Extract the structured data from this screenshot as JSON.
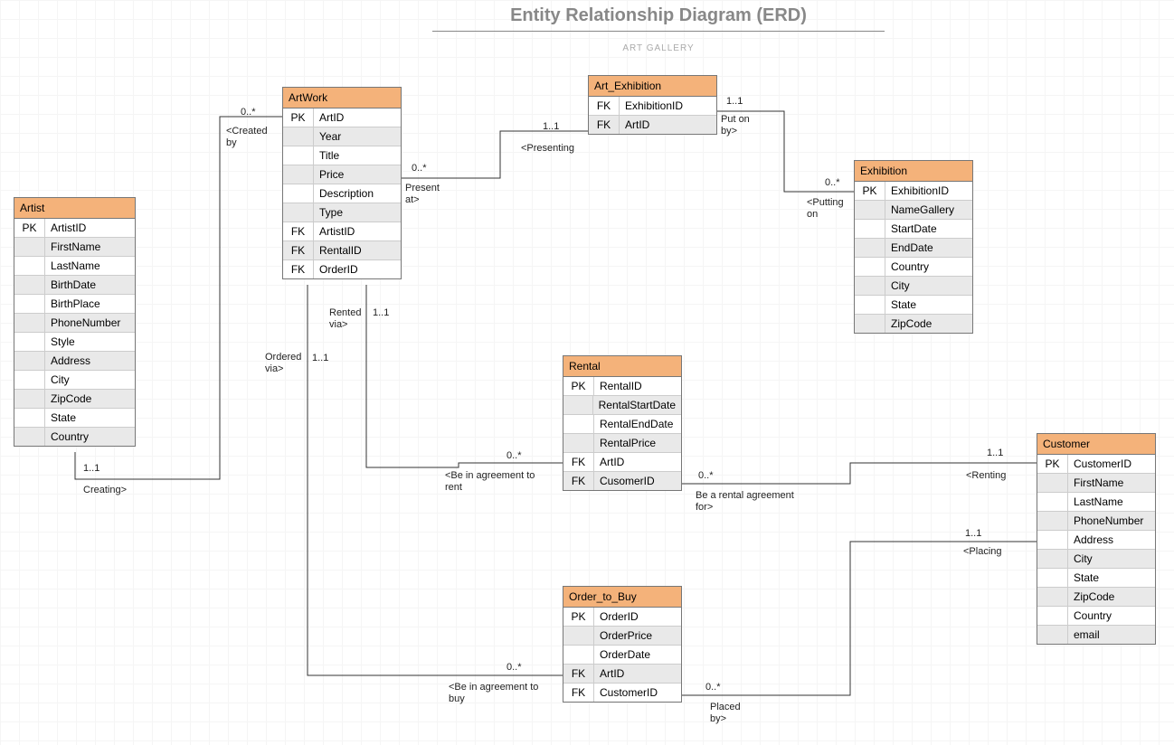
{
  "title": "Entity Relationship Diagram (ERD)",
  "subtitle": "ART GALLERY",
  "entities": {
    "artist": {
      "name": "Artist",
      "rows": [
        {
          "k": "PK",
          "f": "ArtistID"
        },
        {
          "k": "",
          "f": "FirstName"
        },
        {
          "k": "",
          "f": "LastName"
        },
        {
          "k": "",
          "f": "BirthDate"
        },
        {
          "k": "",
          "f": "BirthPlace"
        },
        {
          "k": "",
          "f": "PhoneNumber"
        },
        {
          "k": "",
          "f": "Style"
        },
        {
          "k": "",
          "f": "Address"
        },
        {
          "k": "",
          "f": "City"
        },
        {
          "k": "",
          "f": "ZipCode"
        },
        {
          "k": "",
          "f": "State"
        },
        {
          "k": "",
          "f": "Country"
        }
      ]
    },
    "artwork": {
      "name": "ArtWork",
      "rows": [
        {
          "k": "PK",
          "f": "ArtID"
        },
        {
          "k": "",
          "f": "Year"
        },
        {
          "k": "",
          "f": "Title"
        },
        {
          "k": "",
          "f": "Price"
        },
        {
          "k": "",
          "f": "Description"
        },
        {
          "k": "",
          "f": "Type"
        },
        {
          "k": "FK",
          "f": "ArtistID"
        },
        {
          "k": "FK",
          "f": "RentalID"
        },
        {
          "k": "FK",
          "f": "OrderID"
        }
      ]
    },
    "art_exhibition": {
      "name": "Art_Exhibition",
      "rows": [
        {
          "k": "FK",
          "f": "ExhibitionID"
        },
        {
          "k": "FK",
          "f": "ArtID"
        }
      ]
    },
    "exhibition": {
      "name": "Exhibition",
      "rows": [
        {
          "k": "PK",
          "f": "ExhibitionID"
        },
        {
          "k": "",
          "f": "NameGallery"
        },
        {
          "k": "",
          "f": "StartDate"
        },
        {
          "k": "",
          "f": "EndDate"
        },
        {
          "k": "",
          "f": "Country"
        },
        {
          "k": "",
          "f": "City"
        },
        {
          "k": "",
          "f": "State"
        },
        {
          "k": "",
          "f": "ZipCode"
        }
      ]
    },
    "rental": {
      "name": "Rental",
      "rows": [
        {
          "k": "PK",
          "f": "RentalID"
        },
        {
          "k": "",
          "f": "RentalStartDate"
        },
        {
          "k": "",
          "f": "RentalEndDate"
        },
        {
          "k": "",
          "f": "RentalPrice"
        },
        {
          "k": "FK",
          "f": "ArtID"
        },
        {
          "k": "FK",
          "f": "CusomerID"
        }
      ]
    },
    "order": {
      "name": "Order_to_Buy",
      "rows": [
        {
          "k": "PK",
          "f": "OrderID"
        },
        {
          "k": "",
          "f": "OrderPrice"
        },
        {
          "k": "",
          "f": "OrderDate"
        },
        {
          "k": "FK",
          "f": "ArtID"
        },
        {
          "k": "FK",
          "f": "CustomerID"
        }
      ]
    },
    "customer": {
      "name": "Customer",
      "rows": [
        {
          "k": "PK",
          "f": "CustomerID"
        },
        {
          "k": "",
          "f": "FirstName"
        },
        {
          "k": "",
          "f": "LastName"
        },
        {
          "k": "",
          "f": "PhoneNumber"
        },
        {
          "k": "",
          "f": "Address"
        },
        {
          "k": "",
          "f": "City"
        },
        {
          "k": "",
          "f": "State"
        },
        {
          "k": "",
          "f": "ZipCode"
        },
        {
          "k": "",
          "f": "Country"
        },
        {
          "k": "",
          "f": "email"
        }
      ]
    }
  },
  "labels": {
    "l1": "0..*",
    "l2": "<Created\nby",
    "l3": "1..1",
    "l4": "Creating>",
    "l5": "1..1",
    "l6": "<Presenting",
    "l7": "0..*",
    "l8": "Present\nat>",
    "l9": "1..1",
    "l10": "Put on\nby>",
    "l11": "0..*",
    "l12": "<Putting\non",
    "l13": "Rented\nvia>",
    "l14": "1..1",
    "l15": "0..*",
    "l16": "<Be in agreement to\nrent",
    "l17": "Ordered\nvia>",
    "l18": "1..1",
    "l19": "0..*",
    "l20": "<Be in agreement to\nbuy",
    "l21": "0..*",
    "l22": "Be a rental agreement\nfor>",
    "l23": "1..1",
    "l24": "<Renting",
    "l25": "0..*",
    "l26": "Placed\nby>",
    "l27": "1..1",
    "l28": "<Placing"
  }
}
